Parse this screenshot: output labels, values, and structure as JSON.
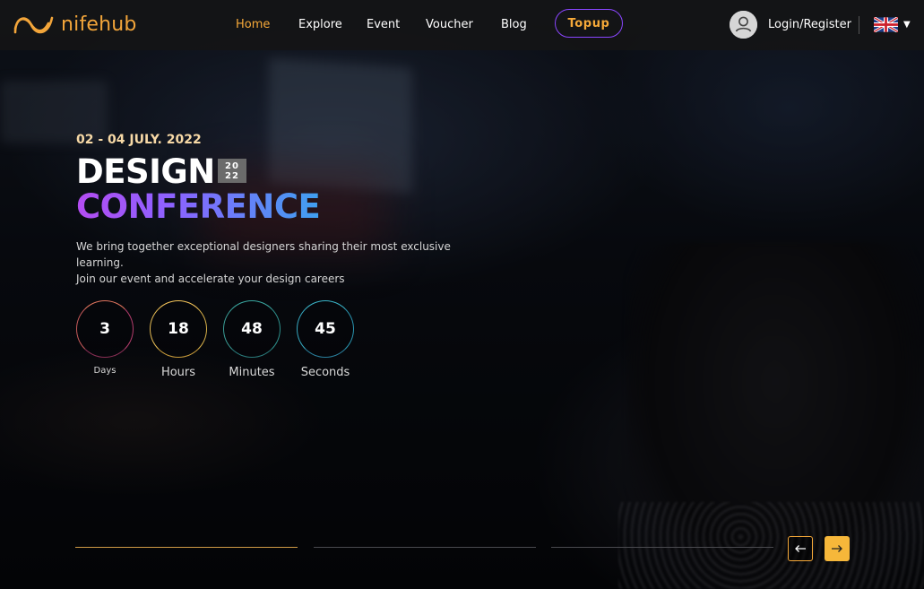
{
  "brand": {
    "name": "nifehub",
    "accent": "#f6a939"
  },
  "nav": {
    "items": [
      "Home",
      "Explore",
      "Event",
      "Voucher",
      "Blog"
    ],
    "active": "Home",
    "topup_label": "Topup",
    "login_label": "Login/Register",
    "language_flag": "uk-flag-icon"
  },
  "hero": {
    "date": "02 - 04 JULY. 2022",
    "title_line1": "DESIGN",
    "year_top": "20",
    "year_bottom": "22",
    "title_line2": "CONFERENCE",
    "description_line1": "We bring together exceptional designers sharing their most exclusive learning.",
    "description_line2": "Join our event and accelerate your design careers"
  },
  "countdown": [
    {
      "value": "3",
      "label": "Days"
    },
    {
      "value": "18",
      "label": "Hours"
    },
    {
      "value": "48",
      "label": "Minutes"
    },
    {
      "value": "45",
      "label": "Seconds"
    }
  ],
  "slider": {
    "slides": 3,
    "active_index": 0,
    "prev_icon": "arrow-left-icon",
    "next_icon": "arrow-right-icon"
  }
}
